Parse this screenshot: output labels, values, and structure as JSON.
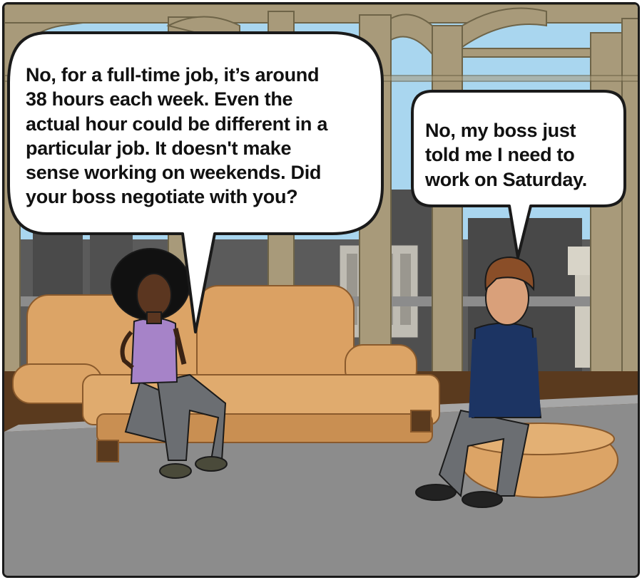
{
  "bubbles": {
    "left": {
      "lines": [
        "No, for a full-time job, it’s around",
        "38 hours each week. Even the",
        "actual hour could be different in a",
        "particular job. It doesn't make",
        "sense working on weekends. Did",
        "your boss negotiate with you?"
      ]
    },
    "right": {
      "lines": [
        "No, my boss just",
        "told me I need to",
        "work on Saturday."
      ]
    }
  },
  "colors": {
    "sky": "#a9d6ef",
    "window_frame": "#a89a7a",
    "sofa": "#dca466",
    "floor": "#8c8c8c",
    "woman_top": "#a683c8",
    "man_shirt": "#1c3463",
    "pants": "#6b6e72"
  }
}
